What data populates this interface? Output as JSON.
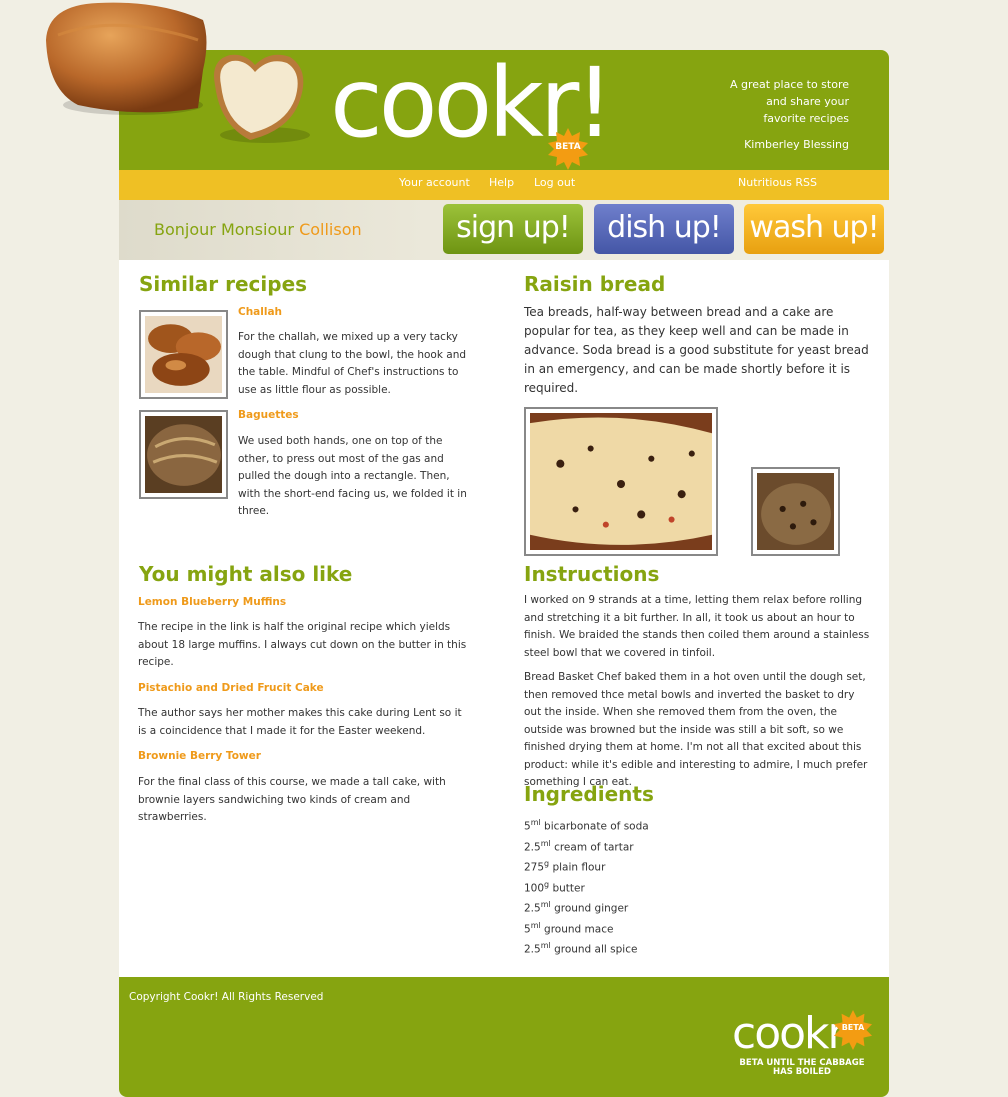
{
  "brand": {
    "logo_text": "cookr!",
    "beta_label": "BETA",
    "tagline_lines": [
      "A great place to store",
      "and share your",
      "favorite recipes"
    ],
    "user_name": "Kimberley Blessing"
  },
  "nav": {
    "your_account": "Your account",
    "help": "Help",
    "log_out": "Log out",
    "rss": "Nutritious RSS"
  },
  "greeting": {
    "prefix": "Bonjour Monsiour",
    "name": "Collison"
  },
  "buttons": {
    "sign_up": "sign up!",
    "dish_up": "dish up!",
    "wash_up": "wash up!"
  },
  "similar": {
    "heading": "Similar recipes",
    "items": [
      {
        "title": "Challah",
        "text": "For the challah, we mixed up a very tacky dough that clung to the bowl, the hook and the table. Mindful of Chef's instructions to use as little flour as possible."
      },
      {
        "title": "Baguettes",
        "text": "We used both hands, one on top of the other, to press out most of the gas and pulled the dough into a rectangle. Then, with the short-end facing us, we folded it in three."
      }
    ]
  },
  "also_like": {
    "heading": "You might also like",
    "items": [
      {
        "title": "Lemon Blueberry Muffins",
        "text": "The recipe in the link is half the original recipe which yields about 18 large muffins. I always cut down on the butter in this recipe."
      },
      {
        "title": "Pistachio and Dried Frucit Cake",
        "text": "The author says her mother makes this cake during Lent so it is a coincidence that I made it for the Easter weekend."
      },
      {
        "title": "Brownie Berry Tower",
        "text": "For the final class of this course, we made a tall cake, with brownie layers sandwiching two kinds of cream and strawberries."
      }
    ]
  },
  "recipe": {
    "title": "Raisin bread",
    "intro": "Tea breads, half-way between bread and a cake are popular for tea, as they keep well and can be made in advance. Soda bread is a good substitute for yeast bread in an emergency, and can be made shortly before it is required.",
    "instructions_heading": "Instructions",
    "instructions": [
      "I worked on 9 strands at a time, letting them relax before rolling and stretching it a bit further. In all, it took us about an hour to finish. We braided the stands then coiled them around a stainless steel bowl that we covered in tinfoil.",
      "Bread Basket Chef baked them in a hot oven until the dough set, then removed thce metal bowls and inverted the basket to dry out the inside. When she removed them from the oven, the outside was browned but the inside was still a bit soft, so we finished drying them at home. I'm not all that excited about this product: while it's edible and interesting to admire, I much prefer something I can eat."
    ],
    "ingredients_heading": "Ingredients",
    "ingredients": [
      {
        "qty": "5",
        "unit": "ml",
        "name": "bicarbonate of soda"
      },
      {
        "qty": "2.5",
        "unit": "ml",
        "name": "cream of tartar"
      },
      {
        "qty": "275",
        "unit": "g",
        "name": "plain flour"
      },
      {
        "qty": "100",
        "unit": "g",
        "name": "butter"
      },
      {
        "qty": "2.5",
        "unit": "ml",
        "name": "ground ginger"
      },
      {
        "qty": "5",
        "unit": "ml",
        "name": "ground mace"
      },
      {
        "qty": "2.5",
        "unit": "ml",
        "name": "ground all spice"
      }
    ]
  },
  "footer": {
    "copyright": "Copyright Cookr! All Rights Reserved",
    "logo_text": "cookr",
    "beta_label": "BETA",
    "tag_lines": [
      "BETA UNTIL THE CABBAGE",
      "HAS BOILED"
    ]
  },
  "colors": {
    "brand_green": "#86a410",
    "accent_orange": "#ef9a1a",
    "nav_yellow": "#efc024",
    "page_bg": "#f1efe4"
  }
}
